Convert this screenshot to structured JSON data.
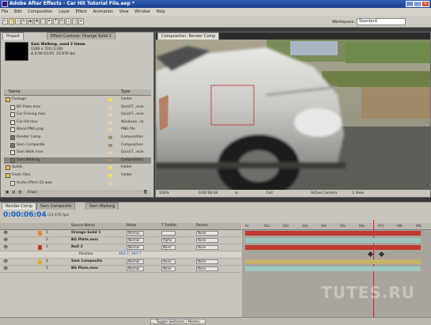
{
  "window": {
    "title": "Adobe After Effects - Car Hit Tutorial File.aep *"
  },
  "menu": [
    "File",
    "Edit",
    "Composition",
    "Layer",
    "Effect",
    "Animation",
    "View",
    "Window",
    "Help"
  ],
  "workspace": {
    "label": "Workspace:",
    "value": "Standard"
  },
  "project_panel": {
    "tab_project": "Project",
    "tab_effect_controls": "Effect Controls: Orange Solid 1",
    "selected_item": "Sam Walking, used 2 times",
    "info_line1": "1280 x 720 (1.00)",
    "info_line2": "Δ 0:00:03:05, 23.976 fps",
    "columns": {
      "name": "Name",
      "type": "Type"
    },
    "items": [
      {
        "name": "Footage",
        "type": "Folder",
        "size": "",
        "indent": 0,
        "kind": "folder",
        "label_color": "#f1e05a"
      },
      {
        "name": "BG Plate.mov",
        "type": "QuickT...ovie",
        "size": "",
        "indent": 1,
        "kind": "footage",
        "label_color": "#d9d2b8"
      },
      {
        "name": "Car Driving.mov",
        "type": "QuickT...ovie",
        "size": "",
        "indent": 1,
        "kind": "footage",
        "label_color": "#d9d2b8"
      },
      {
        "name": "Car Hit.mov",
        "type": "Windows...le",
        "size": "",
        "indent": 1,
        "kind": "footage",
        "label_color": "#d9d2b8"
      },
      {
        "name": "Blood PNG.png",
        "type": "PNG file",
        "size": "",
        "indent": 1,
        "kind": "footage",
        "label_color": "#d9d2b8"
      },
      {
        "name": "Render Comp",
        "type": "Composition",
        "size": "",
        "indent": 1,
        "kind": "comp",
        "label_color": "#9e8f7a"
      },
      {
        "name": "Sam Composite",
        "type": "Composition",
        "size": "",
        "indent": 1,
        "kind": "comp",
        "label_color": "#9e8f7a"
      },
      {
        "name": "Sam Walk.mov",
        "type": "QuickT...ovie",
        "size": "",
        "indent": 1,
        "kind": "footage",
        "label_color": "#d9d2b8"
      },
      {
        "name": "Sam Walking",
        "type": "Composition",
        "size": "",
        "indent": 1,
        "kind": "comp",
        "label_color": "#9e8f7a",
        "selected": true
      },
      {
        "name": "Solids",
        "type": "Folder",
        "size": "",
        "indent": 0,
        "kind": "folder",
        "label_color": "#f1e05a"
      },
      {
        "name": "Fresh Files",
        "type": "Folder",
        "size": "",
        "indent": 0,
        "kind": "folder",
        "label_color": "#f1e05a"
      },
      {
        "name": "Audio Effect 02.wav",
        "type": "",
        "size": "",
        "indent": 1,
        "kind": "footage",
        "label_color": "#d9d2b8"
      }
    ],
    "bit_depth": "8 bpc"
  },
  "comp_panel": {
    "tab": "Composition: Render Comp",
    "zoom": "100%",
    "timecode": "0:00:06:04",
    "resolution": "Full",
    "camera": "Active Camera",
    "views": "1 View"
  },
  "timeline": {
    "tabs": [
      "Render Comp",
      "Sam Composite",
      "Sam Walking"
    ],
    "current_time": "0:00:06:04",
    "fps_label": "(23.976 fps)",
    "columns": {
      "source_name": "Source Name",
      "mode": "Mode",
      "trkmat": "T TrkMat",
      "parent": "Parent"
    },
    "layers": [
      {
        "num": "1",
        "name": "Orange Solid 1",
        "mode": "Normal",
        "trkmat": "",
        "parent": "None",
        "label_color": "#e08a30",
        "bar_color": "#c03a30"
      },
      {
        "num": "2",
        "name": "BG Plate.mov",
        "mode": "Normal",
        "trkmat": "Alpha",
        "parent": "None",
        "label_color": "#c8c8b0",
        "bar_color": "#9cc8c0"
      },
      {
        "num": "3",
        "name": "Null 2",
        "mode": "Normal",
        "trkmat": "None",
        "parent": "None",
        "label_color": "#c03a30",
        "bar_color": "#c03a30"
      },
      {
        "num": "",
        "name": "Position",
        "mode": "",
        "trkmat": "",
        "parent": "",
        "value": "462.7, 197.7",
        "sub": true
      },
      {
        "num": "4",
        "name": "Sam Composite",
        "mode": "Normal",
        "trkmat": "None",
        "parent": "None",
        "label_color": "#e0b030",
        "bar_color": "#c7b26a"
      },
      {
        "num": "5",
        "name": "BG Plate.mov",
        "mode": "Normal",
        "trkmat": "None",
        "parent": "None",
        "label_color": "#c8c8b0",
        "bar_color": "#9cc8c0"
      }
    ],
    "ruler_labels": [
      "0s",
      "01s",
      "02s",
      "03s",
      "04s",
      "05s",
      "06s",
      "07s",
      "08s",
      "09s"
    ],
    "toggle_label": "Toggle Switches / Modes"
  },
  "watermark": "TUTES.RU"
}
